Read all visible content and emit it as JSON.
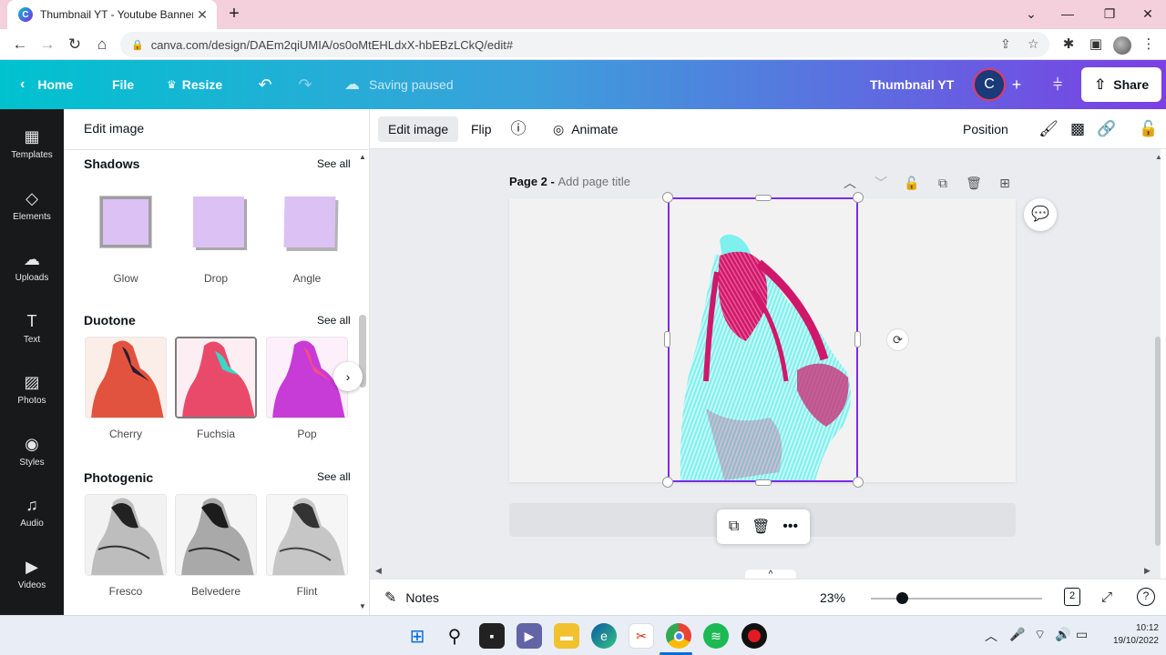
{
  "browser": {
    "tab_title": "Thumbnail YT - Youtube Banner",
    "tab_close": "✕",
    "new_tab": "+",
    "url": "canva.com/design/DAEm2qiUMIA/os0oMtEHLdxX-hbEBzLCkQ/edit#"
  },
  "header": {
    "home": "Home",
    "file": "File",
    "resize": "Resize",
    "save_status": "Saving paused",
    "design_title": "Thumbnail YT",
    "avatar_letter": "C",
    "share": "Share"
  },
  "rail": {
    "items": [
      {
        "label": "Templates",
        "icon": "templates-icon"
      },
      {
        "label": "Elements",
        "icon": "elements-icon"
      },
      {
        "label": "Uploads",
        "icon": "uploads-icon"
      },
      {
        "label": "Text",
        "icon": "text-icon"
      },
      {
        "label": "Photos",
        "icon": "photos-icon"
      },
      {
        "label": "Styles",
        "icon": "styles-icon"
      },
      {
        "label": "Audio",
        "icon": "audio-icon"
      },
      {
        "label": "Videos",
        "icon": "videos-icon"
      }
    ]
  },
  "panel": {
    "title": "Edit image",
    "see_all": "See all",
    "shadows": {
      "heading": "Shadows",
      "items": [
        "Glow",
        "Drop",
        "Angle"
      ]
    },
    "duotone": {
      "heading": "Duotone",
      "items": [
        "Cherry",
        "Fuchsia",
        "Pop"
      ],
      "selected": "Fuchsia"
    },
    "photogenic": {
      "heading": "Photogenic",
      "items": [
        "Fresco",
        "Belvedere",
        "Flint"
      ]
    }
  },
  "toolbar": {
    "edit_image": "Edit image",
    "flip": "Flip",
    "animate": "Animate",
    "position": "Position"
  },
  "canvas": {
    "page_label": "Page 2 - ",
    "page_title_placeholder": "Add page title"
  },
  "bottombar": {
    "notes": "Notes",
    "zoom": "23%",
    "zoom_level": 0.18,
    "page_count": "2"
  },
  "taskbar": {
    "time": "10:12",
    "date": "19/10/2022"
  },
  "colors": {
    "brand_gradient_start": "#00c2cf",
    "brand_gradient_end": "#7b3fe4",
    "selection": "#7d2ae8",
    "duotone_magenta": "#d0186a",
    "duotone_cyan": "#7ef0ee",
    "shadow_swatch": "#dcc1f5"
  }
}
